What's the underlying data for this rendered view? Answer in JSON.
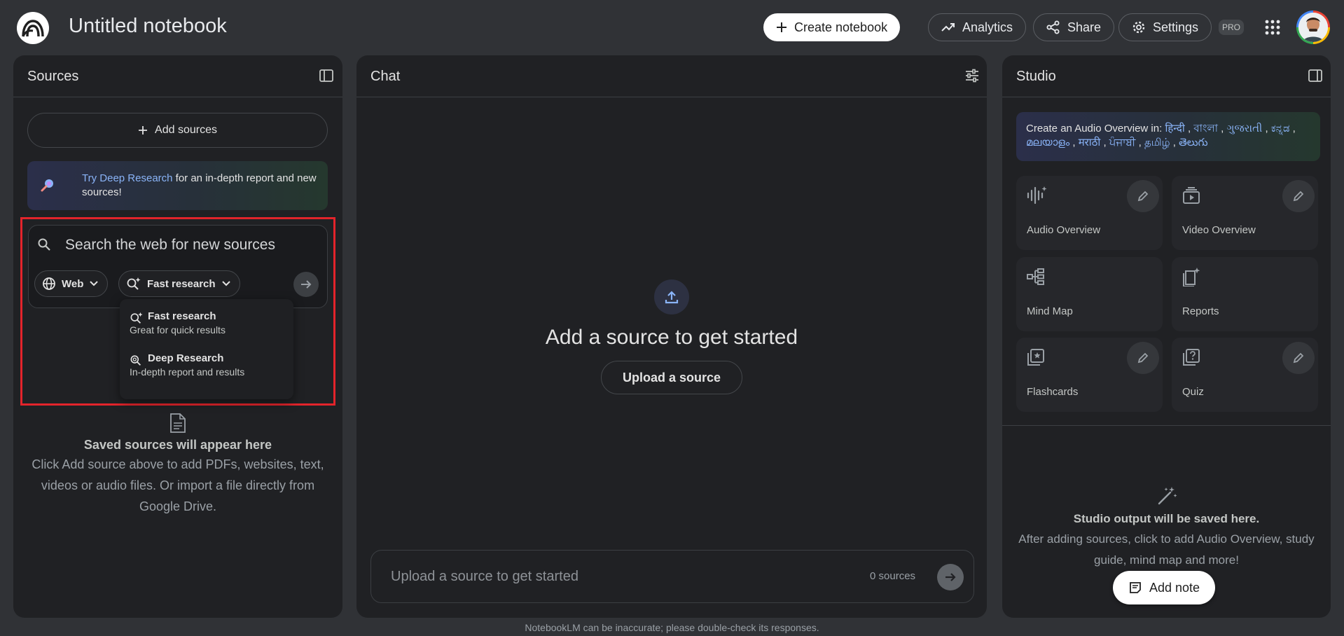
{
  "header": {
    "title": "Untitled notebook",
    "create_label": "Create notebook",
    "analytics_label": "Analytics",
    "share_label": "Share",
    "settings_label": "Settings",
    "pro_badge": "PRO"
  },
  "sources": {
    "title": "Sources",
    "add_label": "Add sources",
    "deep_link": "Try Deep Research",
    "deep_text": " for an in-depth report and new sources!",
    "search_placeholder": "Search the web for new sources",
    "web_chip": "Web",
    "mode_chip": "Fast research",
    "dropdown": [
      {
        "label": "Fast research",
        "sub": "Great for quick results"
      },
      {
        "label": "Deep Research",
        "sub": "In-depth report and results"
      }
    ],
    "empty_title": "Saved sources will appear here",
    "empty_desc": "Click Add source above to add PDFs, websites, text, videos or audio files. Or import a file directly from Google Drive."
  },
  "chat": {
    "title": "Chat",
    "heading": "Add a source to get started",
    "upload_label": "Upload a source",
    "input_placeholder": "Upload a source to get started",
    "source_count": "0 sources"
  },
  "studio": {
    "title": "Studio",
    "lang_prefix": "Create an Audio Overview in: ",
    "languages": [
      "हिन्दी",
      "বাংলা",
      "ગુજરાતી",
      "ಕನ್ನಡ",
      "മലയാളം",
      "मराठी",
      "ਪੰਜਾਬੀ",
      "தமிழ்",
      "తెలుగు"
    ],
    "tiles": [
      "Audio Overview",
      "Video Overview",
      "Mind Map",
      "Reports",
      "Flashcards",
      "Quiz"
    ],
    "empty_title": "Studio output will be saved here.",
    "empty_desc": "After adding sources, click to add Audio Overview, study guide, mind map and more!",
    "add_note_label": "Add note"
  },
  "footer": {
    "disclaimer": "NotebookLM can be inaccurate; please double-check its responses."
  },
  "colors": {
    "background": "#303236",
    "panel": "#202124",
    "link": "#8ab4f8",
    "highlight_box": "#e3242b"
  }
}
